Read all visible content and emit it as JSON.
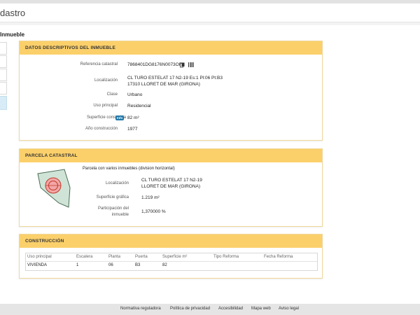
{
  "header": {
    "site_title": "dastro"
  },
  "page": {
    "heading": "Inmueble"
  },
  "datos": {
    "title": "DATOS DESCRIPTIVOS DEL INMUEBLE",
    "rows": [
      {
        "label": "Referencia catastral",
        "value": "7868401DG8176N0073OF"
      },
      {
        "label": "Localización",
        "line1": "CL TURO ESTELAT 17 N2-19 Es:1 Pl:06 Pt:B3",
        "line2": "17310 LLORET DE MAR (GIRONA)"
      },
      {
        "label": "Clase",
        "value": "Urbano"
      },
      {
        "label": "Uso principal",
        "value": "Residencial"
      },
      {
        "label": "Superficie construida",
        "badge": "Info",
        "value": "82 m²"
      },
      {
        "label": "Año construcción",
        "value": "1977"
      }
    ]
  },
  "parcela": {
    "title": "PARCELA CATASTRAL",
    "description": "Parcela con varios inmuebles (division horizontal)",
    "rows": [
      {
        "label": "Localización",
        "line1": "CL TURO ESTELAT 17 N2-19",
        "line2": "LLORET DE MAR (GIRONA)"
      },
      {
        "label": "Superficie gráfica",
        "value": "1.219 m²"
      },
      {
        "label_line1": "Participación del",
        "label_line2": "inmueble",
        "value": "1,370000 %"
      }
    ]
  },
  "construccion": {
    "title": "CONSTRUCCIÓN",
    "headers": [
      "Uso principal",
      "Escalera",
      "Planta",
      "Puerta",
      "Superficie m²",
      "Tipo Reforma",
      "Fecha Reforma"
    ],
    "rows": [
      [
        "VIVIENDA",
        "1",
        "06",
        "B3",
        "82",
        "",
        ""
      ]
    ]
  },
  "footer": {
    "links": [
      "Normativa reguladora",
      "Política de privacidad",
      "Accesibilidad",
      "Mapa web",
      "Aviso legal"
    ]
  },
  "colors": {
    "panel_header": "#fbd06b",
    "badge": "#1f77a8",
    "active_tab": "#d7ecf6"
  },
  "icons": [
    "copy-icon",
    "barcode-icon"
  ]
}
